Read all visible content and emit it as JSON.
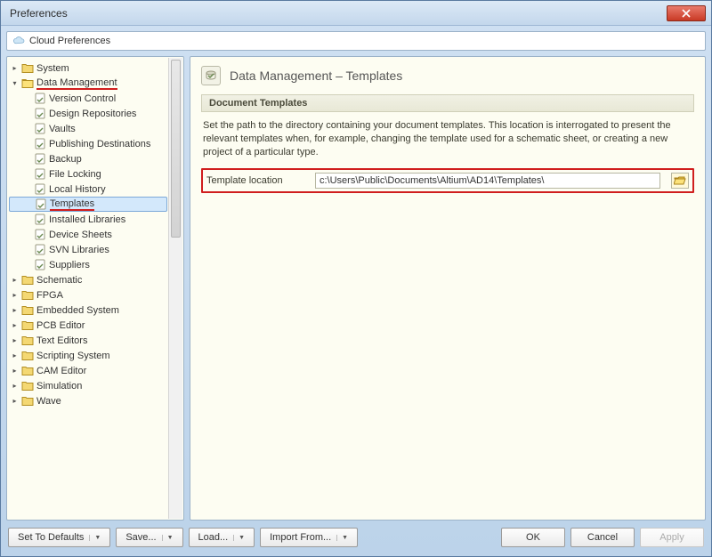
{
  "window": {
    "title": "Preferences"
  },
  "cloudbar": {
    "label": "Cloud Preferences"
  },
  "tree": {
    "top": [
      {
        "name": "System"
      },
      {
        "name": "Data Management",
        "expanded": true,
        "highlight": true
      }
    ],
    "dm_children": [
      "Version Control",
      "Design Repositories",
      "Vaults",
      "Publishing Destinations",
      "Backup",
      "File Locking",
      "Local History",
      "Templates",
      "Installed Libraries",
      "Device Sheets",
      "SVN Libraries",
      "Suppliers"
    ],
    "selected": "Templates",
    "bottom": [
      "Schematic",
      "FPGA",
      "Embedded System",
      "PCB Editor",
      "Text Editors",
      "Scripting System",
      "CAM Editor",
      "Simulation",
      "Wave"
    ]
  },
  "content": {
    "title": "Data Management – Templates",
    "section": "Document Templates",
    "description": "Set the path to the directory containing your document templates. This location is interrogated to present the relevant templates when, for example, changing the template used for a schematic sheet, or creating a new project of a particular type.",
    "field_label": "Template location",
    "path_value": "c:\\Users\\Public\\Documents\\Altium\\AD14\\Templates\\"
  },
  "footer": {
    "defaults": "Set To Defaults",
    "save": "Save...",
    "load": "Load...",
    "import": "Import From...",
    "ok": "OK",
    "cancel": "Cancel",
    "apply": "Apply"
  }
}
